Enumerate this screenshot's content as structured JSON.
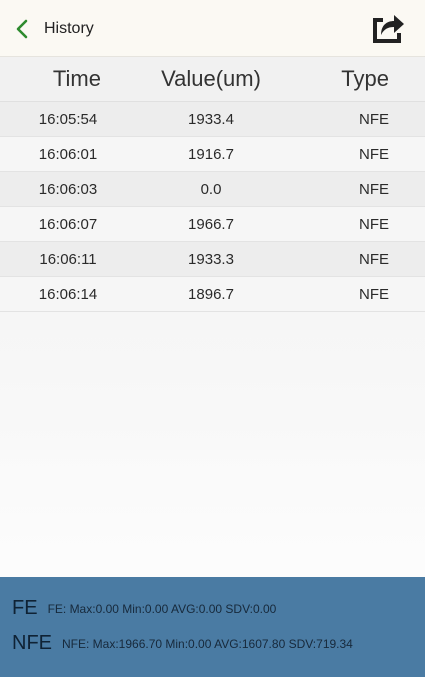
{
  "header": {
    "back_label": "History",
    "back_icon": "chevron-left-icon",
    "share_icon": "share-icon",
    "accent_color": "#2e8b2e"
  },
  "table": {
    "columns": [
      "Time",
      "Value(um)",
      "Type"
    ],
    "rows": [
      {
        "time": "16:05:54",
        "value": "1933.4",
        "type": "NFE"
      },
      {
        "time": "16:06:01",
        "value": "1916.7",
        "type": "NFE"
      },
      {
        "time": "16:06:03",
        "value": "0.0",
        "type": "NFE"
      },
      {
        "time": "16:06:07",
        "value": "1966.7",
        "type": "NFE"
      },
      {
        "time": "16:06:11",
        "value": "1933.3",
        "type": "NFE"
      },
      {
        "time": "16:06:14",
        "value": "1896.7",
        "type": "NFE"
      }
    ]
  },
  "footer": {
    "background_color": "#4a7ba3",
    "fe_label": "FE",
    "fe_stats": "FE: Max:0.00 Min:0.00 AVG:0.00 SDV:0.00",
    "nfe_label": "NFE",
    "nfe_stats": "NFE: Max:1966.70 Min:0.00 AVG:1607.80 SDV:719.34"
  }
}
